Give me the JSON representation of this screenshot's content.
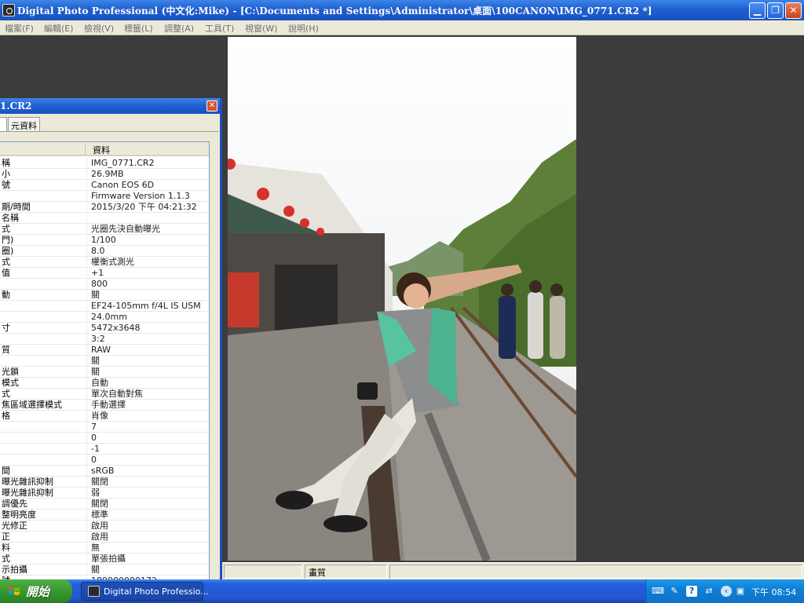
{
  "window": {
    "title": "Digital Photo Professional (中文化:Mike) - [C:\\Documents and Settings\\Administrator\\桌面\\100CANON\\IMG_0771.CR2 *]",
    "min_glyph": "▁",
    "max_glyph": "❐",
    "close_glyph": "✕"
  },
  "menu": {
    "items": [
      "檔案(F)",
      "編輯(E)",
      "檢視(V)",
      "標籤(L)",
      "調整(A)",
      "工具(T)",
      "視窗(W)",
      "說明(H)"
    ]
  },
  "info_panel": {
    "title": "1.CR2",
    "close_glyph": "✕",
    "tab_label": "元資料",
    "column_header": "資料",
    "rows": [
      {
        "k": "稱",
        "v": "IMG_0771.CR2"
      },
      {
        "k": "小",
        "v": "26.9MB"
      },
      {
        "k": "號",
        "v": "Canon EOS 6D"
      },
      {
        "k": "",
        "v": "Firmware Version 1.1.3"
      },
      {
        "k": "期/時間",
        "v": "2015/3/20 下午 04:21:32"
      },
      {
        "k": "名稱",
        "v": ""
      },
      {
        "k": "式",
        "v": "光圈先決自動曝光"
      },
      {
        "k": "門)",
        "v": "1/100"
      },
      {
        "k": "圈)",
        "v": "8.0"
      },
      {
        "k": "式",
        "v": "權衡式測光"
      },
      {
        "k": "值",
        "v": "+1"
      },
      {
        "k": "",
        "v": "800"
      },
      {
        "k": "動",
        "v": "關"
      },
      {
        "k": "",
        "v": "EF24-105mm f/4L IS USM"
      },
      {
        "k": "",
        "v": "24.0mm"
      },
      {
        "k": "寸",
        "v": "5472x3648"
      },
      {
        "k": "",
        "v": "3:2"
      },
      {
        "k": "質",
        "v": "RAW"
      },
      {
        "k": "",
        "v": "關"
      },
      {
        "k": "光鎖",
        "v": "關"
      },
      {
        "k": "模式",
        "v": "自動"
      },
      {
        "k": "式",
        "v": "單次自動對焦"
      },
      {
        "k": "焦區域選擇模式",
        "v": "手動選擇"
      },
      {
        "k": "格",
        "v": "肖像"
      },
      {
        "k": "",
        "v": "7"
      },
      {
        "k": "",
        "v": "0"
      },
      {
        "k": "",
        "v": "-1"
      },
      {
        "k": "",
        "v": "0"
      },
      {
        "k": "間",
        "v": "sRGB"
      },
      {
        "k": "曝光雜訊抑制",
        "v": "關閉"
      },
      {
        "k": "曝光雜訊抑制",
        "v": "弱"
      },
      {
        "k": "調優先",
        "v": "關閉"
      },
      {
        "k": "整明亮度",
        "v": "標準"
      },
      {
        "k": "光修正",
        "v": "啟用"
      },
      {
        "k": "正",
        "v": "啟用"
      },
      {
        "k": "料",
        "v": "無"
      },
      {
        "k": "式",
        "v": "單張拍攝"
      },
      {
        "k": "示拍攝",
        "v": "關"
      },
      {
        "k": "號",
        "v": "189000000172"
      }
    ]
  },
  "statusbar": {
    "quality_label": "畫質"
  },
  "taskbar": {
    "start_label": "開始",
    "task_label": "Digital Photo Professio...",
    "clock": "下午 08:54",
    "tray_icons": [
      "keyboard-icon",
      "pen-icon",
      "help-icon",
      "network-icon",
      "back-arrow-icon",
      "monitor-icon"
    ]
  },
  "colors": {
    "title_blue": "#1f5fd0",
    "menu_bg": "#ece9d8",
    "workspace_bg": "#3c3c3c",
    "start_green": "#33952c",
    "tray_blue": "#0f7fd6"
  }
}
